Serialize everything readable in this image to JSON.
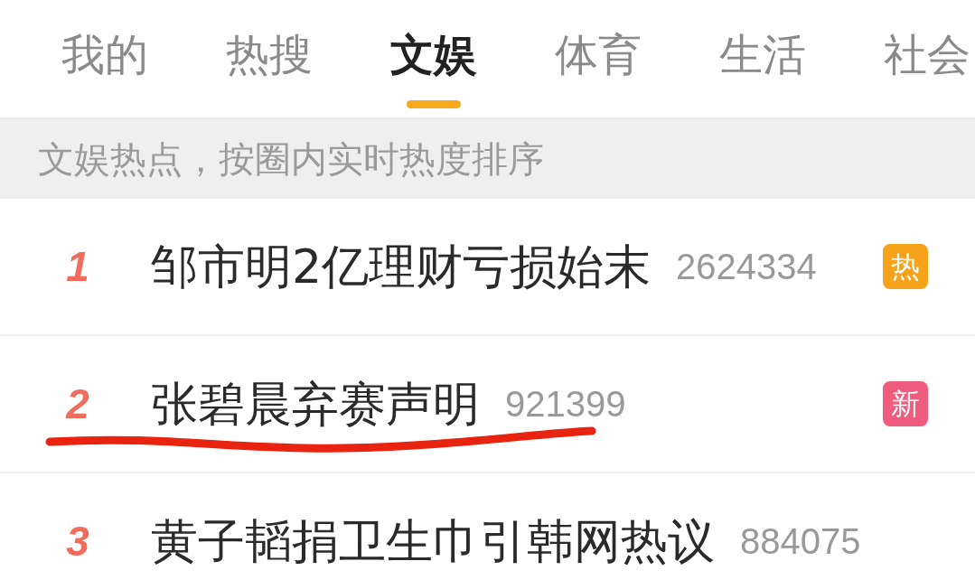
{
  "tabs": [
    {
      "label": "我的",
      "selected": false
    },
    {
      "label": "热搜",
      "selected": false
    },
    {
      "label": "文娱",
      "selected": true
    },
    {
      "label": "体育",
      "selected": false
    },
    {
      "label": "生活",
      "selected": false
    },
    {
      "label": "社会",
      "selected": false
    }
  ],
  "notice": "文娱热点，按圈内实时热度排序",
  "rows": [
    {
      "rank": "1",
      "title": "邹市明2亿理财亏损始末",
      "count": "2624334",
      "badge": {
        "kind": "hot",
        "label": "热"
      },
      "underlined": false
    },
    {
      "rank": "2",
      "title": "张碧晨弃赛声明",
      "count": "921399",
      "badge": {
        "kind": "new",
        "label": "新"
      },
      "underlined": true
    },
    {
      "rank": "3",
      "title": "黄子韬捐卫生巾引韩网热议",
      "count": "884075",
      "underlined": false
    }
  ]
}
